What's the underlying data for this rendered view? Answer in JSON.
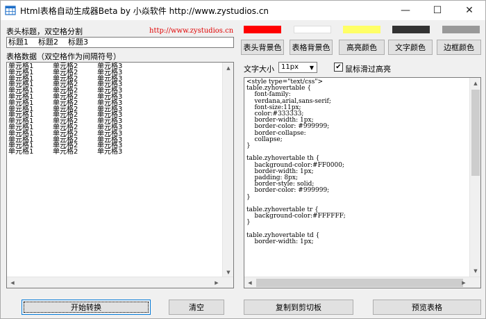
{
  "window": {
    "title": "Html表格自动生成器Beta    by 小焱软件 http://www.zystudios.cn",
    "min_glyph": "—",
    "max_glyph": "☐",
    "close_glyph": "✕"
  },
  "header_section": {
    "label": "表头标题，双空格分割",
    "link": "http://www.zystudios.cn",
    "input_value": "标题1    标题2    标题3"
  },
  "data_section": {
    "label": "表格数据（双空格作为间隔符号）",
    "rows": [
      [
        "单元格1",
        "单元格2",
        "单元格3"
      ],
      [
        "单元格1",
        "单元格2",
        "单元格3"
      ],
      [
        "单元格1",
        "单元格2",
        "单元格3"
      ],
      [
        "单元格1",
        "单元格2",
        "单元格3"
      ],
      [
        "单元格1",
        "单元格2",
        "单元格3"
      ],
      [
        "单元格1",
        "单元格2",
        "单元格3"
      ],
      [
        "单元格1",
        "单元格2",
        "单元格3"
      ],
      [
        "单元格1",
        "单元格2",
        "单元格3"
      ],
      [
        "单元格1",
        "单元格2",
        "单元格3"
      ],
      [
        "单元格1",
        "单元格2",
        "单元格3"
      ],
      [
        "单元格1",
        "单元格2",
        "单元格3"
      ],
      [
        "单元格1",
        "单元格2",
        "单元格3"
      ],
      [
        "单元格1",
        "单元格2",
        "单元格3"
      ],
      [
        "单元格1",
        "单元格2",
        "单元格3"
      ],
      [
        "单元格1",
        "单元格2",
        "单元格3"
      ]
    ]
  },
  "colors": {
    "header_bg": "#FF0000",
    "table_bg": "#FFFFFF",
    "highlight": "#FFFF66",
    "text": "#333333",
    "border": "#999999"
  },
  "color_buttons": {
    "header_bg": "表头背景色",
    "table_bg": "表格背景色",
    "highlight": "高亮颜色",
    "text": "文字颜色",
    "border": "边框颜色"
  },
  "options": {
    "font_size_label": "文字大小",
    "font_size_value": "11px",
    "hover_label": "鼠标滑过高亮",
    "hover_checked": true
  },
  "css_output": "<style type=\"text/css\">\ntable.zyhovertable {\n    font-family:\n    verdana,arial,sans-serif;\n    font-size:11px;\n    color:#333333;\n    border-width: 1px;\n    border-color: #999999;\n    border-collapse:\n    collapse;\n}\n\ntable.zyhovertable th {\n    background-color:#FF0000;\n    border-width: 1px;\n    padding: 8px;\n    border-style: solid;\n    border-color: #999999;\n}\n\ntable.zyhovertable tr {\n    background-color:#FFFFFF;\n}\n\ntable.zyhovertable td {\n    border-width: 1px;",
  "bottom_buttons": {
    "convert": "开始转换",
    "clear": "清空",
    "copy": "复制到剪切板",
    "preview": "预览表格"
  },
  "scroll_glyphs": {
    "up": "▲",
    "down": "▼",
    "left": "◀",
    "right": "▶"
  }
}
